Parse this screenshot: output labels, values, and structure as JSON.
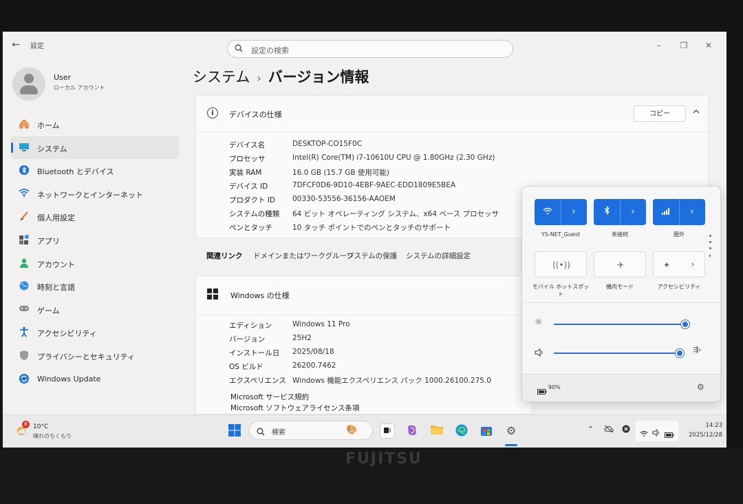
{
  "window": {
    "app_title": "設定"
  },
  "search": {
    "placeholder": "設定の検索"
  },
  "user": {
    "name": "User",
    "account_type": "ローカル アカウント"
  },
  "sidebar": {
    "items": [
      {
        "label": "ホーム",
        "icon": "home-icon"
      },
      {
        "label": "システム",
        "icon": "system-icon"
      },
      {
        "label": "Bluetooth とデバイス",
        "icon": "bluetooth-icon"
      },
      {
        "label": "ネットワークとインターネット",
        "icon": "wifi-icon"
      },
      {
        "label": "個人用設定",
        "icon": "brush-icon"
      },
      {
        "label": "アプリ",
        "icon": "apps-icon"
      },
      {
        "label": "アカウント",
        "icon": "account-icon"
      },
      {
        "label": "時刻と言語",
        "icon": "globe-icon"
      },
      {
        "label": "ゲーム",
        "icon": "gamepad-icon"
      },
      {
        "label": "アクセシビリティ",
        "icon": "accessibility-icon"
      },
      {
        "label": "プライバシーとセキュリティ",
        "icon": "shield-icon"
      },
      {
        "label": "Windows Update",
        "icon": "update-icon"
      }
    ],
    "active_index": 1
  },
  "breadcrumb": {
    "parent": "システム",
    "separator": "›",
    "current": "バージョン情報"
  },
  "device_specs": {
    "title": "デバイスの仕様",
    "copy_label": "コピー",
    "rows": [
      {
        "key": "デバイス名",
        "value": "DESKTOP-CO15F0C"
      },
      {
        "key": "プロセッサ",
        "value": "Intel(R) Core(TM) i7-10610U CPU @ 1.80GHz (2.30 GHz)"
      },
      {
        "key": "実装 RAM",
        "value": "16.0 GB (15.7 GB 使用可能)"
      },
      {
        "key": "デバイス ID",
        "value": "7DFCF0D6-9D10-4EBF-9AEC-EDD1809E5BEA"
      },
      {
        "key": "プロダクト ID",
        "value": "00330-53556-36156-AAOEM"
      },
      {
        "key": "システムの種類",
        "value": "64 ビット オペレーティング システム、x64 ベース プロセッサ"
      },
      {
        "key": "ペンとタッチ",
        "value": "10 タッチ ポイントでのペンとタッチのサポート"
      }
    ]
  },
  "related_links": {
    "title": "関連リンク",
    "links": [
      "ドメインまたはワークグループ",
      "システムの保護",
      "システムの詳細設定"
    ]
  },
  "windows_specs": {
    "title": "Windows の仕様",
    "rows": [
      {
        "key": "エディション",
        "value": "Windows 11 Pro"
      },
      {
        "key": "バージョン",
        "value": "25H2"
      },
      {
        "key": "インストール日",
        "value": "2025/08/18"
      },
      {
        "key": "OS ビルド",
        "value": "26200.7462"
      },
      {
        "key": "エクスペリエンス",
        "value": "Windows 機能エクスペリエンス パック 1000.26100.275.0"
      }
    ],
    "links": [
      "Microsoft サービス規約",
      "Microsoft ソフトウェアライセンス条項"
    ]
  },
  "quick_settings": {
    "tiles": [
      {
        "label": "YS-NET_Guest",
        "icon": "wifi-icon",
        "state": "on"
      },
      {
        "label": "未接続",
        "icon": "bluetooth-icon",
        "state": "on"
      },
      {
        "label": "圏外",
        "icon": "cellular-icon",
        "state": "on"
      },
      {
        "label": "モバイル ホットスポット",
        "icon": "hotspot-icon",
        "state": "off"
      },
      {
        "label": "機内モード",
        "icon": "airplane-icon",
        "state": "off"
      },
      {
        "label": "アクセシビリティ",
        "icon": "accessibility-icon",
        "state": "off"
      }
    ],
    "brightness": 1.0,
    "volume": 0.96,
    "battery": "90%"
  },
  "taskbar": {
    "weather_temp": "10°C",
    "weather_desc": "晴れのちくもり",
    "weather_badge": "8",
    "search_label": "検索",
    "time": "14:23",
    "date": "2025/12/28"
  },
  "hardware": {
    "brand": "FUJITSU"
  },
  "colors": {
    "accent": "#1d6fe0",
    "background": "#f2f1ef"
  }
}
